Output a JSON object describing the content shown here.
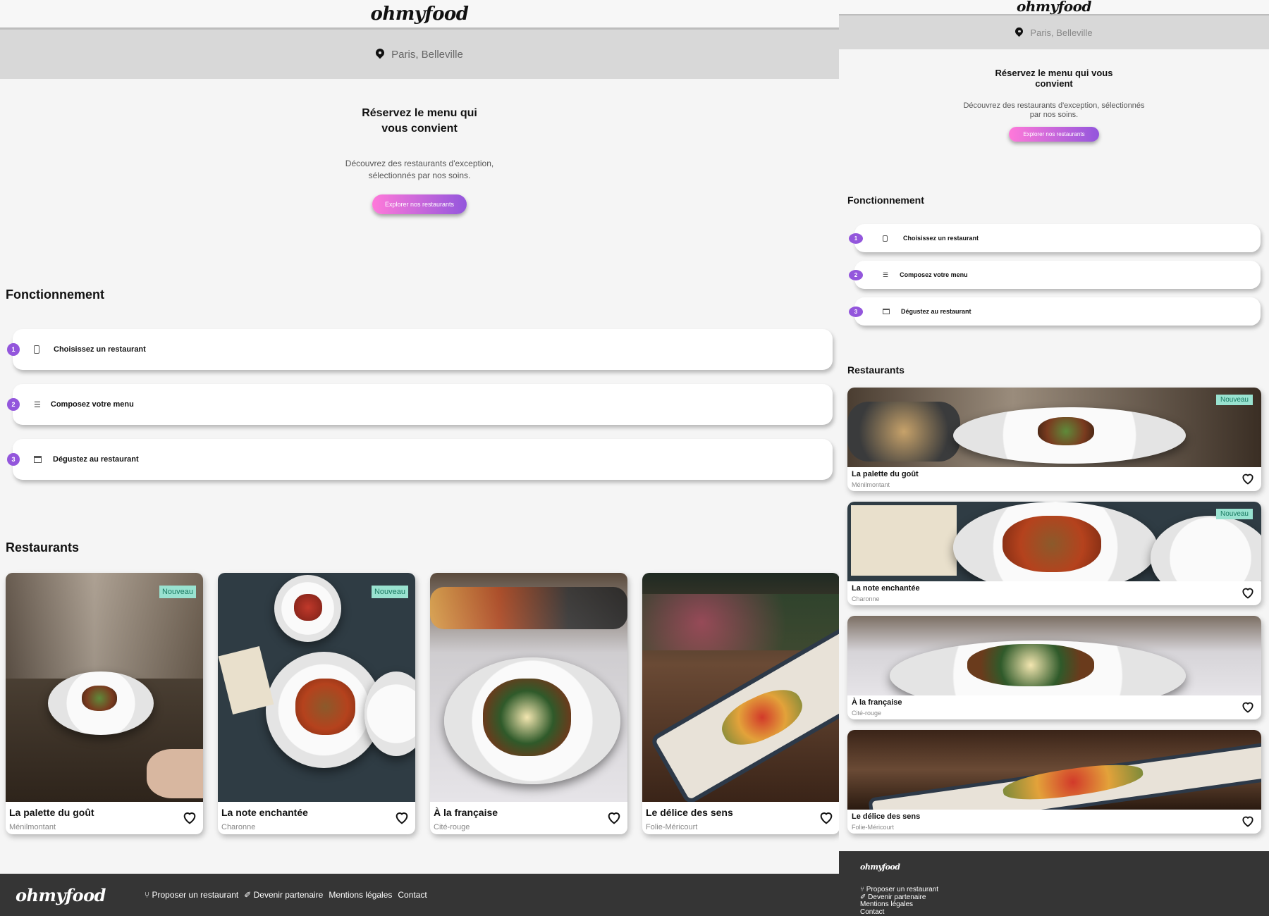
{
  "brand": {
    "logo": "ohmyfood"
  },
  "location": {
    "label": "Paris, Belleville",
    "icon": "map-pin-icon"
  },
  "hero": {
    "title": "Réservez le menu qui vous convient",
    "subtitle": "Découvrez des restaurants d'exception, sélectionnés par nos soins.",
    "cta_label": "Explorer nos restaurants"
  },
  "how_it_works": {
    "heading": "Fonctionnement",
    "steps": [
      {
        "number": "1",
        "icon": "mobile-phone-icon",
        "label": "Choisissez un restaurant"
      },
      {
        "number": "2",
        "icon": "list-icon",
        "label": "Composez votre menu"
      },
      {
        "number": "3",
        "icon": "store-icon",
        "label": "Dégustez au restaurant"
      }
    ]
  },
  "restaurants": {
    "heading": "Restaurants",
    "badge_label": "Nouveau",
    "items": [
      {
        "name": "La palette du goût",
        "area": "Ménilmontant",
        "is_new": true
      },
      {
        "name": "La note enchantée",
        "area": "Charonne",
        "is_new": true
      },
      {
        "name": "À la française",
        "area": "Cité-rouge",
        "is_new": false
      },
      {
        "name": "Le délice des sens",
        "area": "Folie-Méricourt",
        "is_new": false
      }
    ]
  },
  "footer": {
    "logo": "ohmyfood",
    "links": [
      {
        "icon": "utensils-icon",
        "label": "Proposer un restaurant"
      },
      {
        "icon": "handshake-icon",
        "label": "Devenir partenaire"
      },
      {
        "icon": "",
        "label": "Mentions légales"
      },
      {
        "icon": "",
        "label": "Contact"
      }
    ]
  },
  "colors": {
    "accent_purple": "#9356dc",
    "accent_pink": "#ff79da",
    "badge_bg": "#99e2d0",
    "footer_bg": "#353535",
    "location_bar_bg": "#d8d8d8"
  }
}
